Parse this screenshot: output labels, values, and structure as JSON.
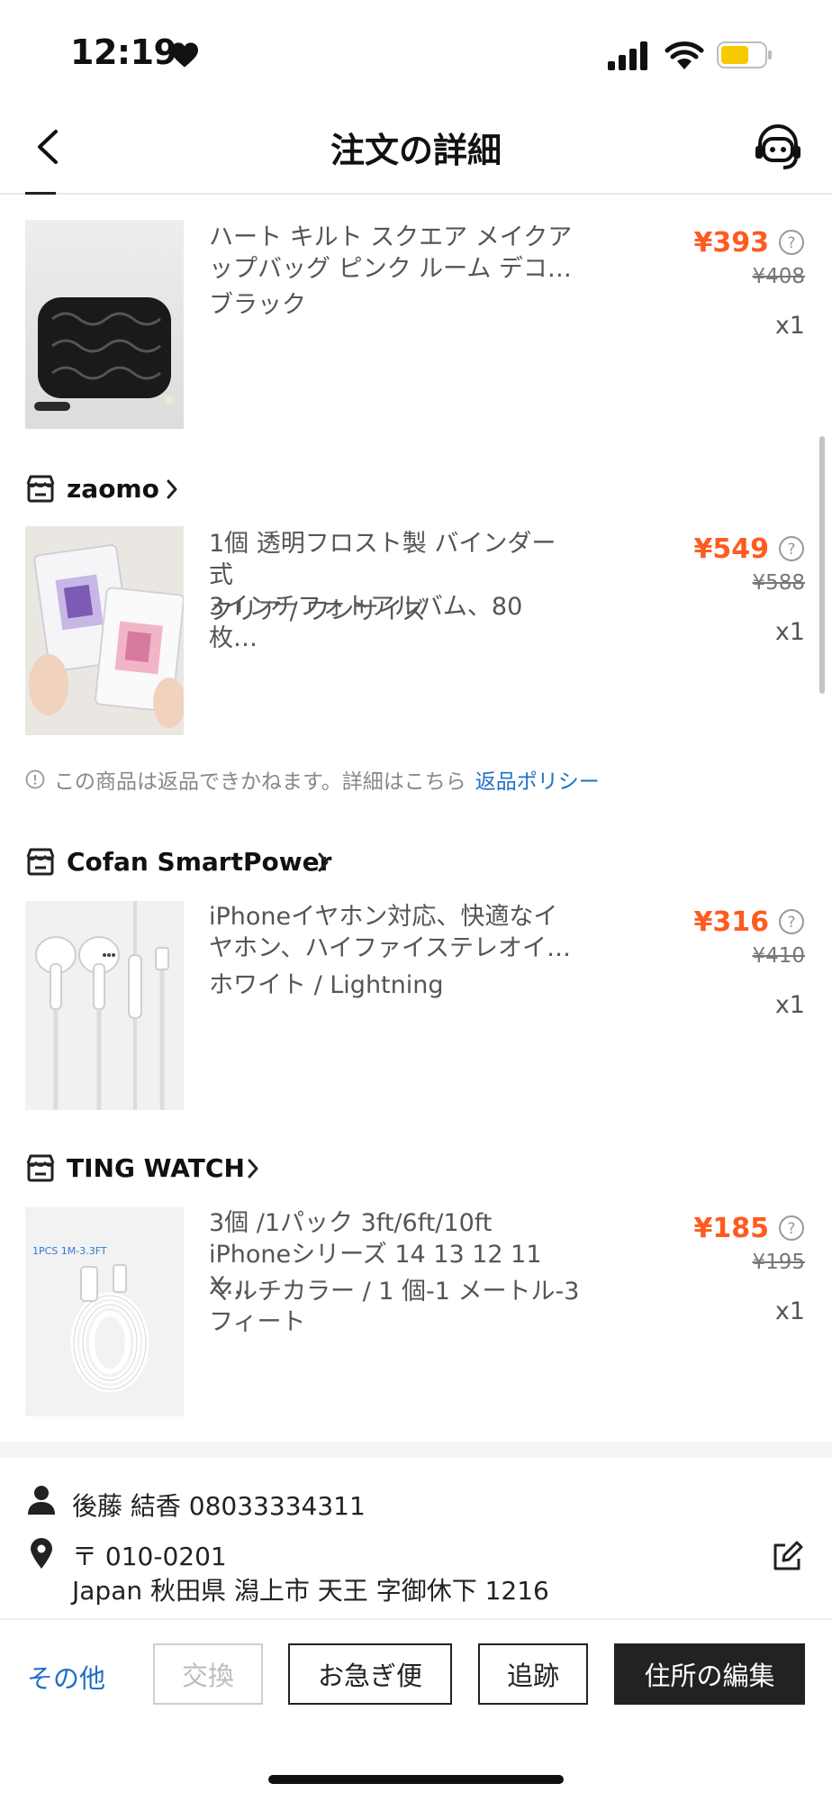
{
  "status_bar": {
    "time": "12:19"
  },
  "header": {
    "title": "注文の詳細"
  },
  "products": [
    {
      "name_line1": "ハート キルト スクエア メイクア",
      "name_line2": "ップバッグ ピンク ルーム デコ…",
      "variant": "ブラック",
      "price": "¥393",
      "original_price": "¥408",
      "qty": "x1"
    },
    {
      "store": "zaomo",
      "name_line1": "1個 透明フロスト製 バインダー式",
      "name_line2": "3インチフォトアルバム、80 枚…",
      "variant": "クリア / ワンサイズ",
      "price": "¥549",
      "original_price": "¥588",
      "qty": "x1"
    },
    {
      "store": "Cofan SmartPower",
      "name_line1": "iPhoneイヤホン対応、快適なイ",
      "name_line2": "ヤホン、ハイファイステレオイ…",
      "variant": "ホワイト / Lightning",
      "price": "¥316",
      "original_price": "¥410",
      "qty": "x1"
    },
    {
      "store": "TING WATCH",
      "name_line1": "3個 /1パック 3ft/6ft/10ft",
      "name_line2": "iPhoneシリーズ 14 13 12 11 X…",
      "variant_line1": "マルチカラー / 1 個-1 メートル-3",
      "variant_line2": "フィート",
      "price": "¥185",
      "original_price": "¥195",
      "qty": "x1",
      "image_label": "1PCS   1M-3.3FT"
    }
  ],
  "notice": {
    "text": "この商品は返品できかねます。詳細はこちら",
    "link": "返品ポリシー"
  },
  "address": {
    "name_phone": "後藤 結香 08033334311",
    "postal": "〒 010-0201",
    "line": "Japan 秋田県 潟上市 天王 字御休下 1216"
  },
  "actions": {
    "more": "その他",
    "exchange": "交換",
    "express": "お急ぎ便",
    "track": "追跡",
    "edit_address": "住所の編集"
  },
  "colors": {
    "price": "#ff5a1f",
    "link": "#1f6fc5",
    "primary_button": "#222222"
  }
}
